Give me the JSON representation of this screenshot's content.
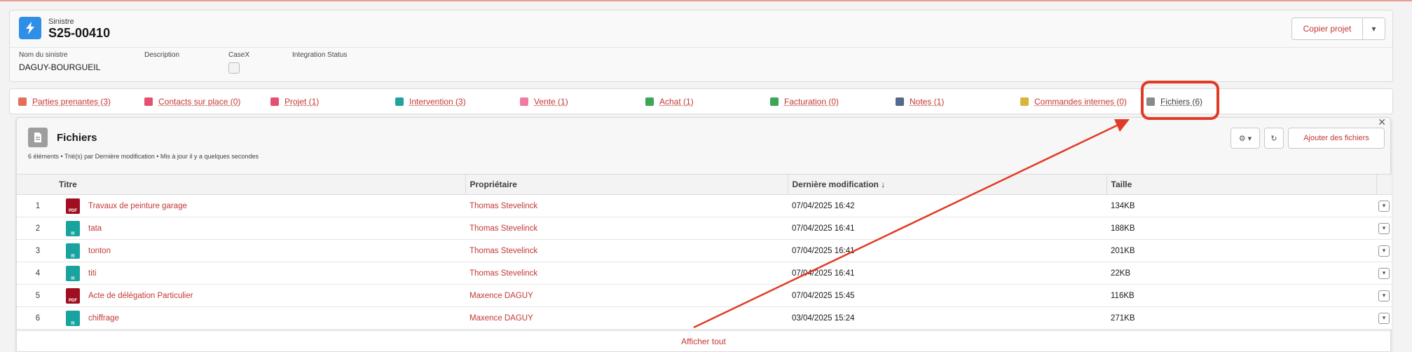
{
  "header": {
    "type_label": "Sinistre",
    "title": "S25-00410",
    "copy_button": "Copier projet",
    "fields": [
      {
        "label": "Nom du sinistre",
        "value": "DAGUY-BOURGUEIL"
      },
      {
        "label": "Description",
        "value": ""
      },
      {
        "label": "CaseX",
        "value": ""
      },
      {
        "label": "Integration Status",
        "value": ""
      }
    ]
  },
  "tabs": [
    {
      "label": "Parties prenantes (3)",
      "color": "#e4705c"
    },
    {
      "label": "Contacts sur place (0)",
      "color": "#e4506f"
    },
    {
      "label": "Projet (1)",
      "color": "#e4506f"
    },
    {
      "label": "Intervention (3)",
      "color": "#20a39e"
    },
    {
      "label": "Vente (1)",
      "color": "#f07aa3"
    },
    {
      "label": "Achat (1)",
      "color": "#3ba755"
    },
    {
      "label": "Facturation (0)",
      "color": "#3ba755"
    },
    {
      "label": "Notes (1)",
      "color": "#54698d"
    },
    {
      "label": "Commandes internes (0)",
      "color": "#d8b537"
    },
    {
      "label": "Fichiers (6)",
      "color": "#8a8a8a"
    }
  ],
  "files": {
    "title": "Fichiers",
    "subtitle": "6 éléments • Trié(s) par Dernière modification • Mis à jour il y a quelques secondes",
    "add_button": "Ajouter des fichiers",
    "columns": [
      "Titre",
      "Propriétaire",
      "Dernière modification ↓",
      "Taille"
    ],
    "rows": [
      {
        "n": "1",
        "type": "pdf",
        "title": "Travaux de peinture garage",
        "owner": "Thomas Stevelinck",
        "modified": "07/04/2025 16:42",
        "size": "134KB"
      },
      {
        "n": "2",
        "type": "doc",
        "title": "tata",
        "owner": "Thomas Stevelinck",
        "modified": "07/04/2025 16:41",
        "size": "188KB"
      },
      {
        "n": "3",
        "type": "doc",
        "title": "tonton",
        "owner": "Thomas Stevelinck",
        "modified": "07/04/2025 16:41",
        "size": "201KB"
      },
      {
        "n": "4",
        "type": "doc",
        "title": "titi",
        "owner": "Thomas Stevelinck",
        "modified": "07/04/2025 16:41",
        "size": "22KB"
      },
      {
        "n": "5",
        "type": "pdf",
        "title": "Acte de délégation Particulier",
        "owner": "Maxence DAGUY",
        "modified": "07/04/2025 15:45",
        "size": "116KB"
      },
      {
        "n": "6",
        "type": "doc",
        "title": "chiffrage",
        "owner": "Maxence DAGUY",
        "modified": "03/04/2025 15:24",
        "size": "271KB"
      }
    ],
    "footer_link": "Afficher tout"
  },
  "colors": {
    "accent": "#c23934",
    "annotation": "#e23b25",
    "record_icon": "#2f8fe6"
  }
}
